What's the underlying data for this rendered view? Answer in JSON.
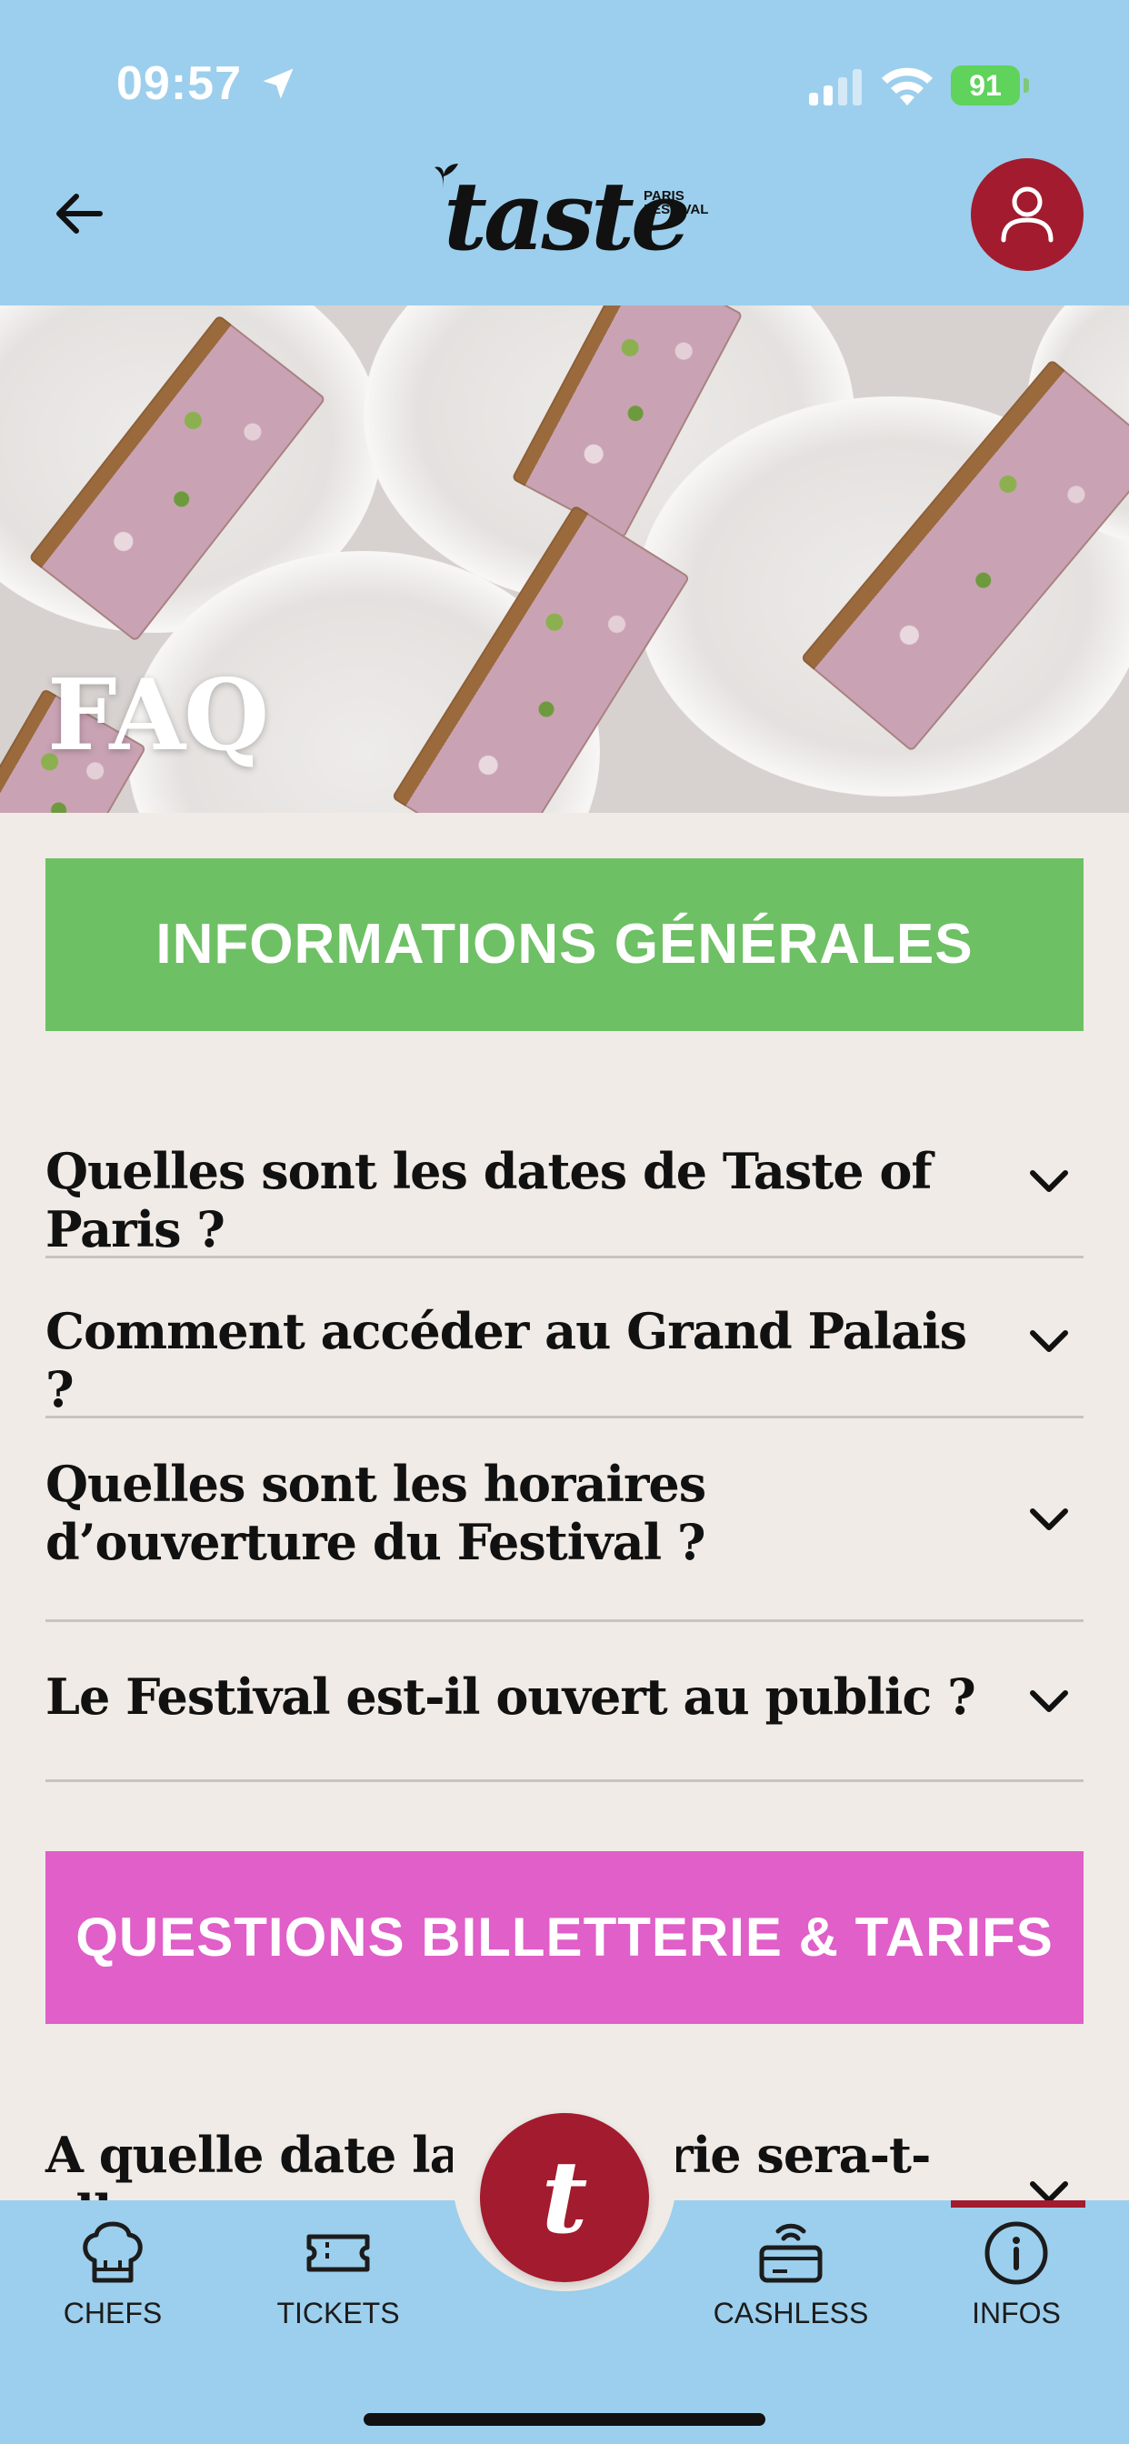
{
  "status_bar": {
    "time": "09:57",
    "battery": "91"
  },
  "header": {
    "logo_text": "taste",
    "logo_sub": "PARIS FESTIVAL",
    "back_icon": "arrow-left-icon",
    "profile_icon": "user-icon"
  },
  "hero": {
    "title": "FAQ"
  },
  "sections": [
    {
      "title": "INFORMATIONS GÉNÉRALES",
      "color": "#6dc064",
      "questions": [
        "Quelles sont les dates de Taste of Paris ?",
        "Comment accéder au Grand Palais ?",
        "Quelles sont les horaires d’ouverture du Festival ?",
        "Le Festival est-il ouvert au public ?"
      ]
    },
    {
      "title": "QUESTIONS BILLETTERIE & TARIFS",
      "color": "#e05fc8",
      "questions": [
        "A quelle date la billetterie sera-t-elle"
      ]
    }
  ],
  "bottom_nav": {
    "items": [
      {
        "label": "CHEFS",
        "icon": "chef-hat-icon"
      },
      {
        "label": "TICKETS",
        "icon": "ticket-icon"
      },
      {
        "label": "CASHLESS",
        "icon": "card-wireless-icon"
      },
      {
        "label": "INFOS",
        "icon": "info-icon"
      }
    ],
    "center_label": "t",
    "active": "INFOS"
  },
  "colors": {
    "brand": "#a31b2e",
    "sky": "#9ccfed",
    "background": "#f0ebe6"
  }
}
